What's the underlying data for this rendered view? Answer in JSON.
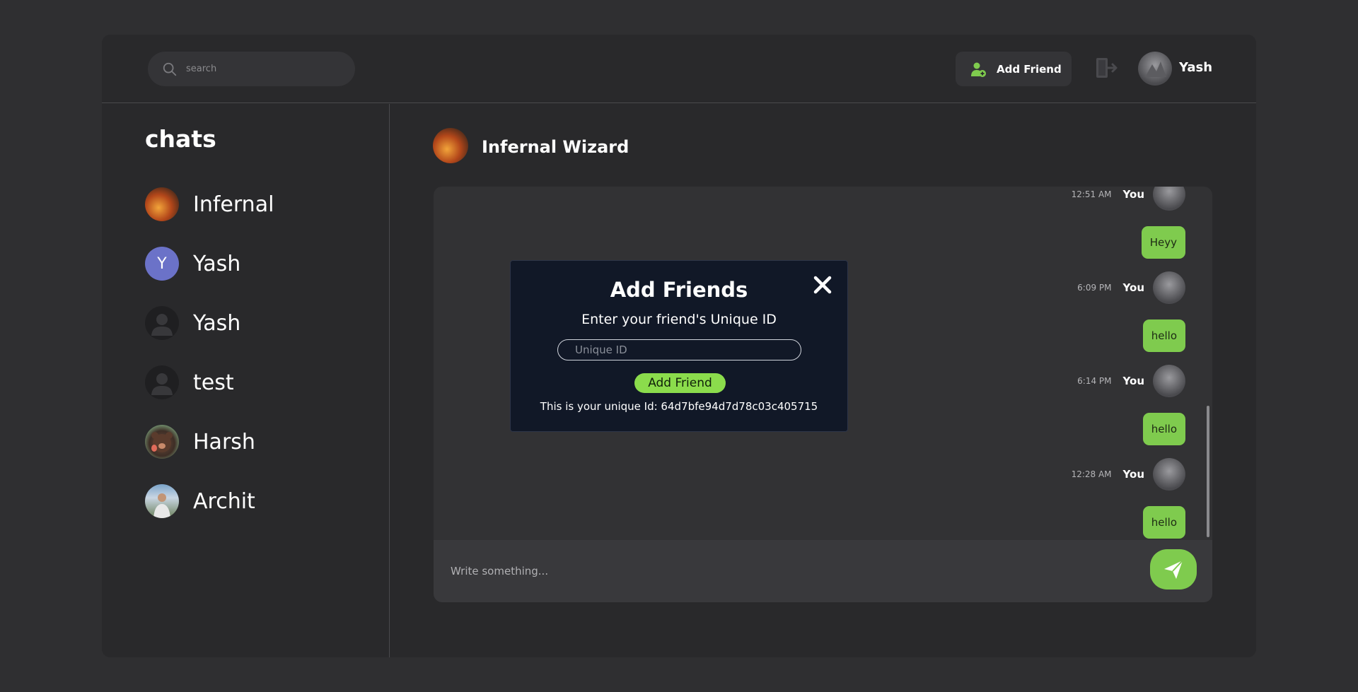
{
  "header": {
    "search_placeholder": "search",
    "add_friend_label": "Add Friend",
    "user_name": "Yash"
  },
  "sidebar": {
    "title": "chats",
    "items": [
      {
        "name": "Infernal",
        "avatar": "infernal-avatar"
      },
      {
        "name": "Yash",
        "avatar": "letter-avatar",
        "initial": "Y"
      },
      {
        "name": "Yash",
        "avatar": "default-user-avatar"
      },
      {
        "name": "test",
        "avatar": "default-user-avatar"
      },
      {
        "name": "Harsh",
        "avatar": "bear-avatar"
      },
      {
        "name": "Archit",
        "avatar": "photo-avatar"
      }
    ]
  },
  "chat": {
    "contact_name": "Infernal Wizard",
    "messages": [
      {
        "time": "12:51 AM",
        "sender": "You",
        "text": "Heyy"
      },
      {
        "time": "6:09 PM",
        "sender": "You",
        "text": "hello"
      },
      {
        "time": "6:14 PM",
        "sender": "You",
        "text": "hello"
      },
      {
        "time": "12:28 AM",
        "sender": "You",
        "text": "hello"
      }
    ],
    "composer_placeholder": "Write something..."
  },
  "modal": {
    "title": "Add Friends",
    "subtitle": "Enter your friend's Unique ID",
    "input_placeholder": "Unique ID",
    "button_label": "Add Friend",
    "unique_id_text": "This is your unique Id: 64d7bfe94d7d78c03c405715"
  },
  "colors": {
    "accent": "#7fcb4e",
    "background": "#2f2f31",
    "panel": "#29292b",
    "modal_bg": "#111827"
  }
}
